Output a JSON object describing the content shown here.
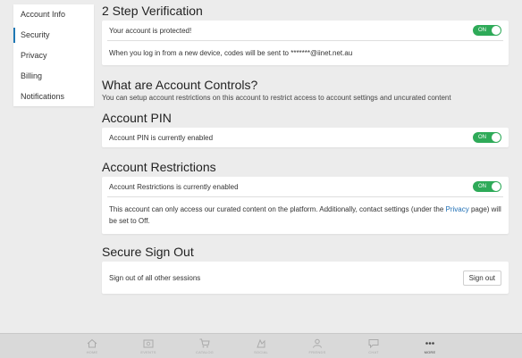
{
  "sidebar": {
    "items": [
      {
        "label": "Account Info"
      },
      {
        "label": "Security"
      },
      {
        "label": "Privacy"
      },
      {
        "label": "Billing"
      },
      {
        "label": "Notifications"
      }
    ]
  },
  "two_step": {
    "title": "2 Step Verification",
    "status_text": "Your account is protected!",
    "toggle": "ON",
    "info_text": "When you log in from a new device, codes will be sent to *******@iinet.net.au"
  },
  "account_controls": {
    "title": "What are Account Controls?",
    "description": "You can setup account restrictions on this account to restrict access to account settings and uncurated content"
  },
  "account_pin": {
    "title": "Account PIN",
    "status_text": "Account PIN is currently enabled",
    "toggle": "ON"
  },
  "account_restrictions": {
    "title": "Account Restrictions",
    "status_text": "Account Restrictions is currently enabled",
    "toggle": "ON",
    "info_part1": "This account can only access our curated content on the platform. Additionally, contact settings (under the ",
    "info_link": "Privacy",
    "info_part2": " page) will be set to Off."
  },
  "secure_sign_out": {
    "title": "Secure Sign Out",
    "text": "Sign out of all other sessions",
    "button": "Sign out"
  },
  "bottom_nav": {
    "items": [
      {
        "label": "HOME",
        "icon": "home-icon"
      },
      {
        "label": "EVENTS",
        "icon": "events-icon"
      },
      {
        "label": "CATALOG",
        "icon": "cart-icon"
      },
      {
        "label": "SOCIAL",
        "icon": "social-icon"
      },
      {
        "label": "FRIENDS",
        "icon": "friends-icon"
      },
      {
        "label": "CHAT",
        "icon": "chat-icon"
      },
      {
        "label": "MORE",
        "icon": "more-icon"
      }
    ]
  },
  "colors": {
    "toggle_on": "#2eaa58",
    "link": "#1f6fb5",
    "background": "#ececec",
    "sidebar_active": "#1f78b4"
  }
}
